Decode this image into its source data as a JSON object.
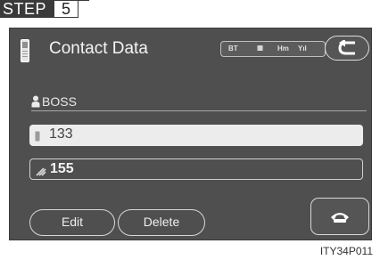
{
  "step": {
    "label": "STEP",
    "number": "5"
  },
  "header": {
    "title": "Contact Data",
    "status": {
      "bt": "BT",
      "battery": "IIIII",
      "hm": "Hm",
      "signal": "Yıl"
    },
    "back_icon": "back-arrow-icon"
  },
  "contact": {
    "name": "BOSS",
    "numbers": [
      {
        "icon": "mobile-phone-icon",
        "value": "133",
        "highlighted": true
      },
      {
        "icon": "pen-icon",
        "value": "155",
        "highlighted": false
      }
    ]
  },
  "buttons": {
    "edit": "Edit",
    "delete": "Delete",
    "call_icon": "phone-handset-icon"
  },
  "caption": "ITY34P011",
  "colors": {
    "screen_bg": "#4f4f4f",
    "highlight_field": "#ececec",
    "border": "#d8d8d8"
  }
}
